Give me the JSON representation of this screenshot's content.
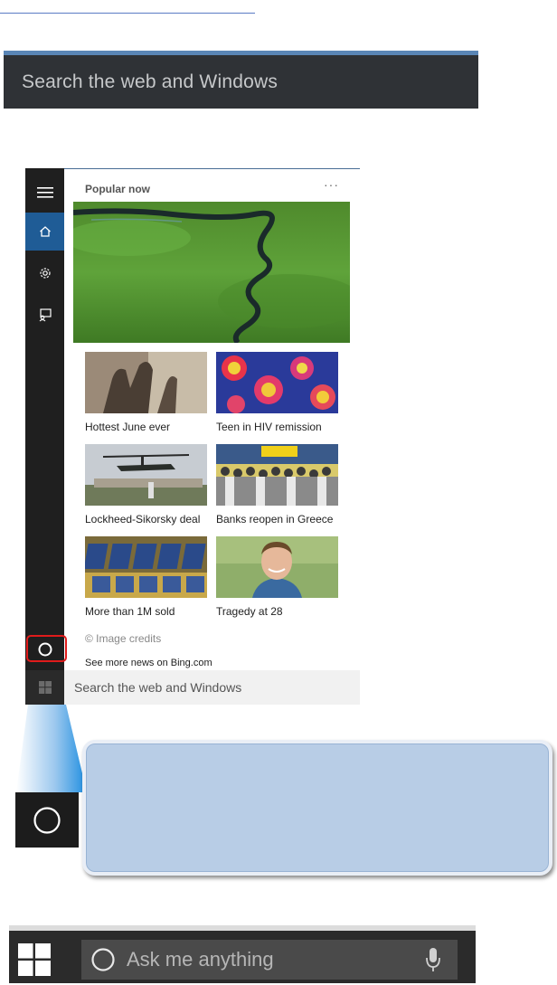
{
  "top_search": {
    "placeholder": "Search the web and Windows"
  },
  "cortana_panel": {
    "section_title": "Popular now",
    "more_menu": "···",
    "news": [
      {
        "caption": "Hottest June ever"
      },
      {
        "caption": "Teen in HIV remission"
      },
      {
        "caption": "Lockheed-Sikorsky deal"
      },
      {
        "caption": "Banks reopen in Greece"
      },
      {
        "caption": "More than 1M sold"
      },
      {
        "caption": "Tragedy at 28"
      }
    ],
    "image_credits": "© Image credits",
    "more_news": "See more news on Bing.com",
    "search_placeholder": "Search the web and Windows"
  },
  "taskbar": {
    "ask_placeholder": "Ask me anything"
  },
  "icons": {
    "hamburger": "hamburger-menu-icon",
    "home": "home-icon",
    "settings": "gear-icon",
    "feedback": "feedback-icon",
    "cortana": "cortana-circle-icon",
    "windows": "windows-logo-icon",
    "microphone": "microphone-icon"
  },
  "colors": {
    "accent_blue": "#1f5c96",
    "highlight_red": "#e01b1b",
    "callout_fill": "#b8cde6"
  }
}
